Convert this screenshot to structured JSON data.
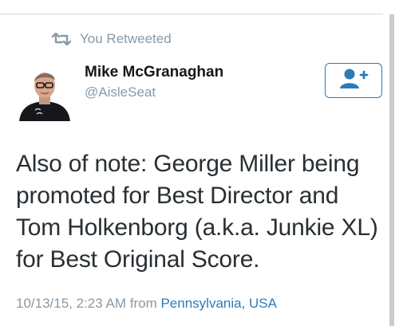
{
  "retweet": {
    "label": "You Retweeted",
    "icon": "retweet-icon",
    "color": "#8899a6"
  },
  "author": {
    "name": "Mike McGranaghan",
    "handle": "@AisleSeat",
    "avatar_icon": "profile-photo",
    "follow_icon": "follow-user-icon"
  },
  "tweet": {
    "text_lines": [
      "Also of note: George Miller being",
      "promoted for Best Director and",
      "Tom Holkenborg (a.k.a. Junkie XL)",
      "for Best Original Score."
    ],
    "timestamp": "10/13/15, 2:23 AM",
    "from_word": "from",
    "location": "Pennsylvania, USA"
  },
  "colors": {
    "accent": "#2b7bb9",
    "muted": "#8899a6",
    "text": "#292f33"
  }
}
